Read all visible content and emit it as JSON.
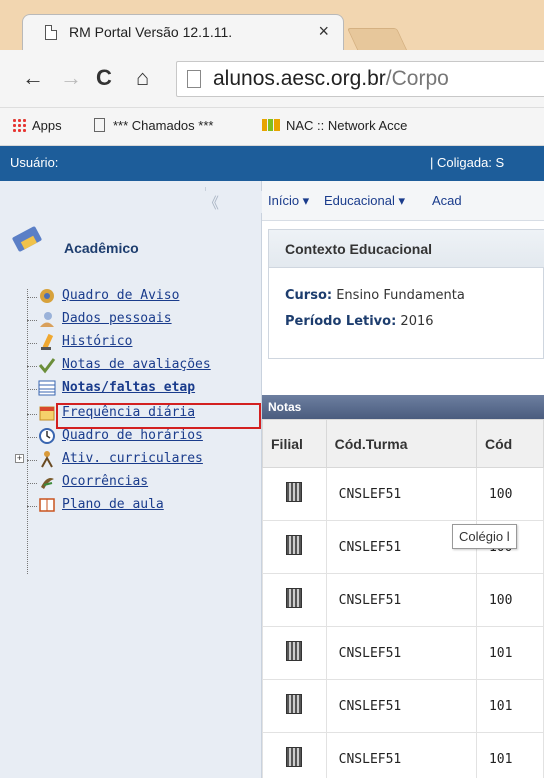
{
  "browser": {
    "tab_title": "RM Portal Versão 12.1.11.",
    "address_host": "alunos.aesc.org.br",
    "address_path": "/Corpo",
    "bookmarks": [
      "Apps",
      "*** Chamados ***",
      "NAC :: Network Acce"
    ]
  },
  "userbar": {
    "user_label": "Usuário:",
    "coligada_label": "| Coligada: S"
  },
  "sidebar": {
    "section_title": "Acadêmico",
    "items": [
      {
        "label": "Quadro de Aviso",
        "icon": "megaphone-icon"
      },
      {
        "label": "Dados pessoais",
        "icon": "person-icon"
      },
      {
        "label": "Histórico",
        "icon": "pencil-icon"
      },
      {
        "label": "Notas de avaliações",
        "icon": "check-icon"
      },
      {
        "label": "Notas/faltas etap",
        "icon": "table-icon"
      },
      {
        "label": "Frequência diária",
        "icon": "calendar-icon"
      },
      {
        "label": "Quadro de horários",
        "icon": "clock-icon"
      },
      {
        "label": "Ativ. curriculares",
        "icon": "people-icon"
      },
      {
        "label": "Ocorrências",
        "icon": "flag-icon"
      },
      {
        "label": "Plano de aula",
        "icon": "book-icon"
      }
    ]
  },
  "main": {
    "menu": [
      "Início ▾",
      "Educacional ▾",
      "Acad"
    ],
    "context_title": "Contexto Educacional",
    "curso_label": "Curso:",
    "curso_value": "Ensino Fundamenta",
    "periodo_label": "Período Letivo:",
    "periodo_value": "2016",
    "notas_title": "Notas",
    "columns": [
      "Filial",
      "Cód.Turma",
      "Cód"
    ],
    "rows": [
      {
        "turma": "CNSLEF51",
        "cod": "100"
      },
      {
        "turma": "CNSLEF51",
        "cod": "100"
      },
      {
        "turma": "CNSLEF51",
        "cod": "100"
      },
      {
        "turma": "CNSLEF51",
        "cod": "101"
      },
      {
        "turma": "CNSLEF51",
        "cod": "101"
      },
      {
        "turma": "CNSLEF51",
        "cod": "101"
      }
    ],
    "tooltip": "Colégio l"
  }
}
